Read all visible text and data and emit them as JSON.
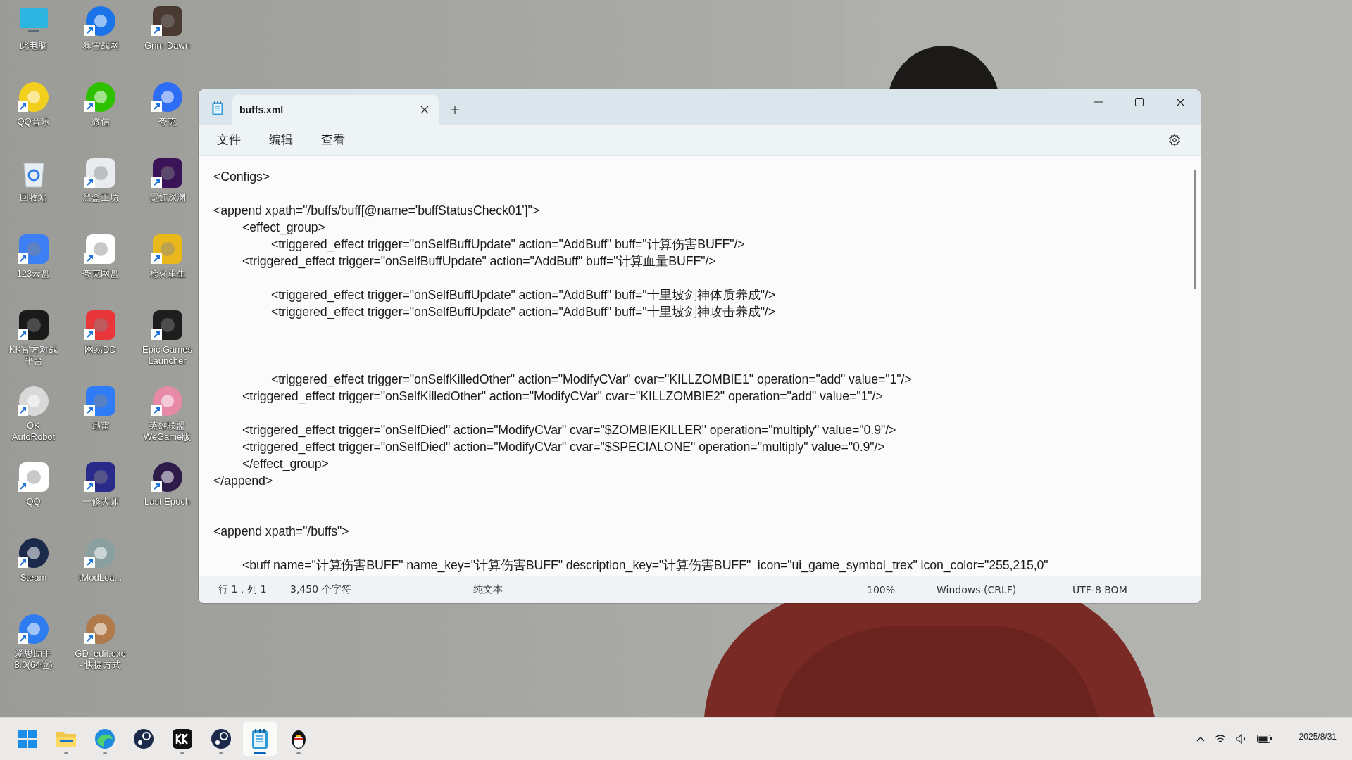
{
  "desktop": {
    "shortcuts": [
      {
        "label_lines": [
          "此电脑"
        ],
        "kind": "monitor",
        "color": "#2bb5e0",
        "shortcut": false
      },
      {
        "label_lines": [
          "QQ音乐"
        ],
        "kind": "round",
        "color": "#f2cf1d",
        "shortcut": true
      },
      {
        "label_lines": [
          "回收站"
        ],
        "kind": "bin",
        "color": "#e6edf3",
        "shortcut": false
      },
      {
        "label_lines": [
          "123云盘"
        ],
        "kind": "tile",
        "color": "#3d7ff5",
        "shortcut": true
      },
      {
        "label_lines": [
          "KK官方对战",
          "平台"
        ],
        "kind": "tile",
        "color": "#1a1a1a",
        "shortcut": true
      },
      {
        "label_lines": [
          "OK",
          "AutoRobot"
        ],
        "kind": "round",
        "color": "#d9d9d9",
        "shortcut": true
      },
      {
        "label_lines": [
          "QQ"
        ],
        "kind": "tile",
        "color": "#ffffff",
        "shortcut": true
      },
      {
        "label_lines": [
          "Steam"
        ],
        "kind": "round",
        "color": "#1b2a4a",
        "shortcut": true
      },
      {
        "label_lines": [
          "爱思助手",
          "8.0(64位)"
        ],
        "kind": "round",
        "color": "#2d7cf0",
        "shortcut": true
      },
      {
        "label_lines": [
          "暴雪战网"
        ],
        "kind": "round",
        "color": "#1a73e8",
        "shortcut": true
      },
      {
        "label_lines": [
          "微信"
        ],
        "kind": "round",
        "color": "#2dc100",
        "shortcut": true
      },
      {
        "label_lines": [
          "黑盒工坊"
        ],
        "kind": "tile",
        "color": "#e9ecef",
        "shortcut": true
      },
      {
        "label_lines": [
          "夸克网盘"
        ],
        "kind": "tile",
        "color": "#ffffff",
        "shortcut": true
      },
      {
        "label_lines": [
          "网易DD"
        ],
        "kind": "tile",
        "color": "#e8363b",
        "shortcut": true
      },
      {
        "label_lines": [
          "迅雷"
        ],
        "kind": "tile",
        "color": "#2f7cf6",
        "shortcut": true
      },
      {
        "label_lines": [
          "一修大师"
        ],
        "kind": "tile",
        "color": "#2a2a8a",
        "shortcut": true
      },
      {
        "label_lines": [
          "tModLoa..."
        ],
        "kind": "round",
        "color": "#8aa0a0",
        "shortcut": true
      },
      {
        "label_lines": [
          "GD_edit.exe",
          "- 快捷方式"
        ],
        "kind": "round",
        "color": "#b07a4a",
        "shortcut": true
      },
      {
        "label_lines": [
          "Grim Dawn"
        ],
        "kind": "tile",
        "color": "#4a3a32",
        "shortcut": true
      },
      {
        "label_lines": [
          "夸克"
        ],
        "kind": "round",
        "color": "#2d6cf5",
        "shortcut": true
      },
      {
        "label_lines": [
          "霓虹深渊"
        ],
        "kind": "tile",
        "color": "#3a1457",
        "shortcut": true
      },
      {
        "label_lines": [
          "枪火重生"
        ],
        "kind": "tile",
        "color": "#e8b81c",
        "shortcut": true
      },
      {
        "label_lines": [
          "Epic Games",
          "Launcher"
        ],
        "kind": "tile",
        "color": "#1e1e1e",
        "shortcut": true
      },
      {
        "label_lines": [
          "英雄联盟",
          "WeGame版"
        ],
        "kind": "round",
        "color": "#e68aa8",
        "shortcut": true
      },
      {
        "label_lines": [
          "Last Epoch"
        ],
        "kind": "round",
        "color": "#2e1b4a",
        "shortcut": true
      }
    ]
  },
  "window": {
    "tabs": [
      {
        "label": "buffs.xml",
        "selected": true
      }
    ],
    "menu": [
      "文件",
      "编辑",
      "查看"
    ],
    "editor": {
      "text": "<Configs>\n\n<append xpath=\"/buffs/buff[@name='buffStatusCheck01']\">\n\t<effect_group>\n\t\t<triggered_effect trigger=\"onSelfBuffUpdate\" action=\"AddBuff\" buff=\"计算伤害BUFF\"/>\n\t<triggered_effect trigger=\"onSelfBuffUpdate\" action=\"AddBuff\" buff=\"计算血量BUFF\"/>\n\n\t\t<triggered_effect trigger=\"onSelfBuffUpdate\" action=\"AddBuff\" buff=\"十里坡剑神体质养成\"/>\n\t\t<triggered_effect trigger=\"onSelfBuffUpdate\" action=\"AddBuff\" buff=\"十里坡剑神攻击养成\"/>\n\n\n\n\t\t<triggered_effect trigger=\"onSelfKilledOther\" action=\"ModifyCVar\" cvar=\"KILLZOMBIE1\" operation=\"add\" value=\"1\"/>\n\t<triggered_effect trigger=\"onSelfKilledOther\" action=\"ModifyCVar\" cvar=\"KILLZOMBIE2\" operation=\"add\" value=\"1\"/>\n\n\t<triggered_effect trigger=\"onSelfDied\" action=\"ModifyCVar\" cvar=\"$ZOMBIEKILLER\" operation=\"multiply\" value=\"0.9\"/>\n\t<triggered_effect trigger=\"onSelfDied\" action=\"ModifyCVar\" cvar=\"$SPECIALONE\" operation=\"multiply\" value=\"0.9\"/>\n\t</effect_group>\n</append>\n\n\n<append xpath=\"/buffs\">\n\n\t<buff name=\"计算伤害BUFF\" name_key=\"计算伤害BUFF\" description_key=\"计算伤害BUFF\"  icon=\"ui_game_symbol_trex\" icon_color=\"255,215,0\""
    },
    "status_bar": [
      "行 1，列 1",
      "3,450 个字符",
      "纯文本",
      "100%",
      "Windows (CRLF)",
      "UTF-8 BOM"
    ]
  },
  "taskbar": {
    "items": [
      {
        "kind": "start",
        "running": false,
        "selected": false
      },
      {
        "kind": "folder",
        "running": true,
        "selected": false
      },
      {
        "kind": "browser",
        "running": true,
        "selected": false
      },
      {
        "kind": "steam",
        "running": false,
        "selected": false
      },
      {
        "kind": "kk",
        "running": true,
        "selected": false
      },
      {
        "kind": "steam",
        "running": true,
        "selected": false
      },
      {
        "kind": "notepad",
        "running": true,
        "selected": true
      },
      {
        "kind": "penguin",
        "running": true,
        "selected": false
      }
    ],
    "date": "2025/8/31"
  }
}
